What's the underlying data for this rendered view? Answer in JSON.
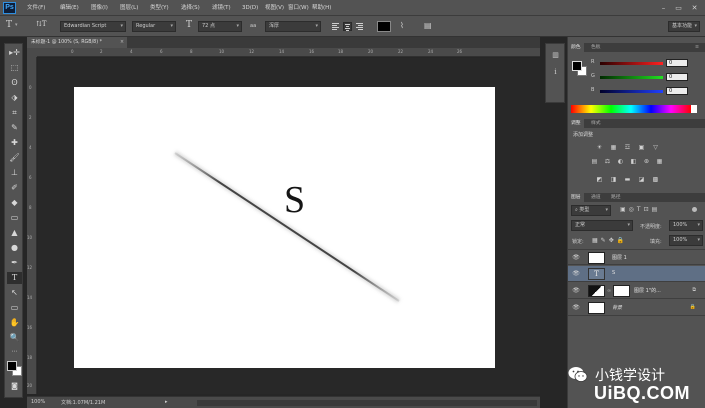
{
  "app": {
    "logo": "Ps"
  },
  "menu": [
    "文件(F)",
    "编辑(E)",
    "图像(I)",
    "图层(L)",
    "类型(Y)",
    "选择(S)",
    "滤镜(T)",
    "3D(D)",
    "视图(V)",
    "窗口(W)",
    "帮助(H)"
  ],
  "window_controls": {
    "minimize": "–",
    "restore": "▭",
    "close": "✕"
  },
  "options": {
    "tool_icon": "T",
    "orient_icon": "⇅T",
    "font_family": "Edwardian Script",
    "font_style": "Regular",
    "size_icon": "T",
    "font_size": "72 点",
    "aa_icon": "aa",
    "antialias": "浑厚",
    "workspace": "基本功能",
    "text_color": "#000000"
  },
  "document": {
    "tab_title": "未标题-1 @ 100% (S, RGB/8) *",
    "tab_close": "×",
    "canvas_text": "S",
    "zoom": "100%",
    "doc_info": "文档:1.07M/1.21M",
    "ruler_top": [
      "0",
      "2",
      "4",
      "6",
      "8",
      "10",
      "12",
      "14",
      "16",
      "18",
      "20",
      "22",
      "24",
      "26"
    ],
    "ruler_left": [
      "0",
      "2",
      "4",
      "6",
      "8",
      "10",
      "12",
      "14",
      "16",
      "18",
      "20"
    ]
  },
  "tools": [
    "▸✛",
    "⬚",
    "ʘ",
    "⬗",
    "⌗",
    "✎",
    "✚",
    "🖌",
    "⊥",
    "✐",
    "◆",
    "▭",
    "▲",
    "●",
    "✒",
    "T",
    "↖",
    "▭",
    "✋",
    "🔍",
    "⋯"
  ],
  "panel_strip_icons": [
    "▥",
    "i"
  ],
  "color_panel": {
    "tabs": [
      "颜色",
      "色板"
    ],
    "channels": [
      {
        "label": "R",
        "value": "0",
        "track": "#e21b1b"
      },
      {
        "label": "G",
        "value": "0",
        "track": "#1bbf1b"
      },
      {
        "label": "B",
        "value": "0",
        "track": "#1b4fe0"
      }
    ]
  },
  "adjustments_panel": {
    "tabs": [
      "调整",
      "样式"
    ],
    "title": "添加调整",
    "icons_row1": [
      "☀",
      "▦",
      "☲",
      "▣",
      "▽"
    ],
    "icons_row2": [
      "▤",
      "⚖",
      "◐",
      "◧",
      "⊛",
      "▦"
    ],
    "icons_row3": [
      "◩",
      "◨",
      "▬",
      "◪",
      "▩"
    ]
  },
  "layers_panel": {
    "tabs": [
      "图层",
      "通道",
      "路径"
    ],
    "filter": "类型",
    "blend_mode": "正常",
    "opacity_label": "不透明度:",
    "opacity": "100%",
    "lock_label": "锁定:",
    "fill_label": "填充:",
    "fill": "100%",
    "layers": [
      {
        "name": "图层 1",
        "type": "raster",
        "selected": false,
        "locked": false
      },
      {
        "name": "S",
        "type": "text",
        "selected": true,
        "locked": false
      },
      {
        "name": "图层 1\"的...",
        "type": "shape",
        "selected": false,
        "locked": false
      },
      {
        "name": "背景",
        "type": "background",
        "selected": false,
        "locked": true
      }
    ]
  },
  "watermark": {
    "chinese": "小钱学设计",
    "logo": "UiBQ.COM"
  }
}
